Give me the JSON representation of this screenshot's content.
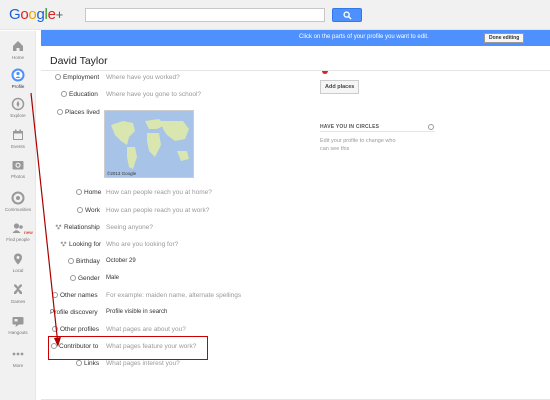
{
  "header": {
    "search_placeholder": ""
  },
  "nav": [
    {
      "label": "Home",
      "icon": "home-icon"
    },
    {
      "label": "Profile",
      "icon": "profile-icon"
    },
    {
      "label": "Explore",
      "icon": "explore-icon"
    },
    {
      "label": "Events",
      "icon": "events-icon"
    },
    {
      "label": "Photos",
      "icon": "photos-icon"
    },
    {
      "label": "Communities",
      "icon": "communities-icon"
    },
    {
      "label": "Find people",
      "icon": "find-people-icon",
      "badge": "new"
    },
    {
      "label": "Local",
      "icon": "local-icon"
    },
    {
      "label": "Games",
      "icon": "games-icon"
    },
    {
      "label": "Hangouts",
      "icon": "hangouts-icon"
    },
    {
      "label": "More",
      "icon": "more-icon"
    }
  ],
  "banner": {
    "text": "Click on the parts of your profile you want to edit.",
    "done_label": "Done editing"
  },
  "profile": {
    "name": "David Taylor",
    "map_credit": "©2013 Google"
  },
  "fields": [
    {
      "label": "Employment",
      "value": "Where have you worked?",
      "icon": "globe-icon"
    },
    {
      "label": "Education",
      "value": "Where have you gone to school?",
      "icon": "globe-icon"
    },
    {
      "label": "Places lived",
      "value": "",
      "icon": "globe-icon"
    },
    {
      "label": "Home",
      "value": "How can people reach you at home?",
      "icon": "circle-icon"
    },
    {
      "label": "Work",
      "value": "How can people reach you at work?",
      "icon": "circle-icon"
    },
    {
      "label": "Relationship",
      "value": "Seeing anyone?",
      "icon": "people-icon"
    },
    {
      "label": "Looking for",
      "value": "Who are you looking for?",
      "icon": "people-icon"
    },
    {
      "label": "Birthday",
      "value": "October 29",
      "icon": "circle-icon"
    },
    {
      "label": "Gender",
      "value": "Male",
      "icon": "globe-icon"
    },
    {
      "label": "Other names",
      "value": "For example: maiden name, alternate spellings",
      "icon": "globe-icon"
    },
    {
      "label": "Profile discovery",
      "value": "Profile visible in search",
      "icon": ""
    },
    {
      "label": "Other profiles",
      "value": "What pages are about you?",
      "icon": "globe-icon"
    },
    {
      "label": "Contributor to",
      "value": "What pages feature your work?",
      "icon": "globe-icon"
    },
    {
      "label": "Links",
      "value": "What pages interest you?",
      "icon": "globe-icon"
    }
  ],
  "right": {
    "add_places_label": "Add places",
    "circles_title": "HAVE YOU IN CIRCLES",
    "circles_text": "Edit your profile to change who can see this"
  },
  "colors": {
    "accent_blue": "#4d90fe",
    "highlight_red": "#cc0000"
  }
}
